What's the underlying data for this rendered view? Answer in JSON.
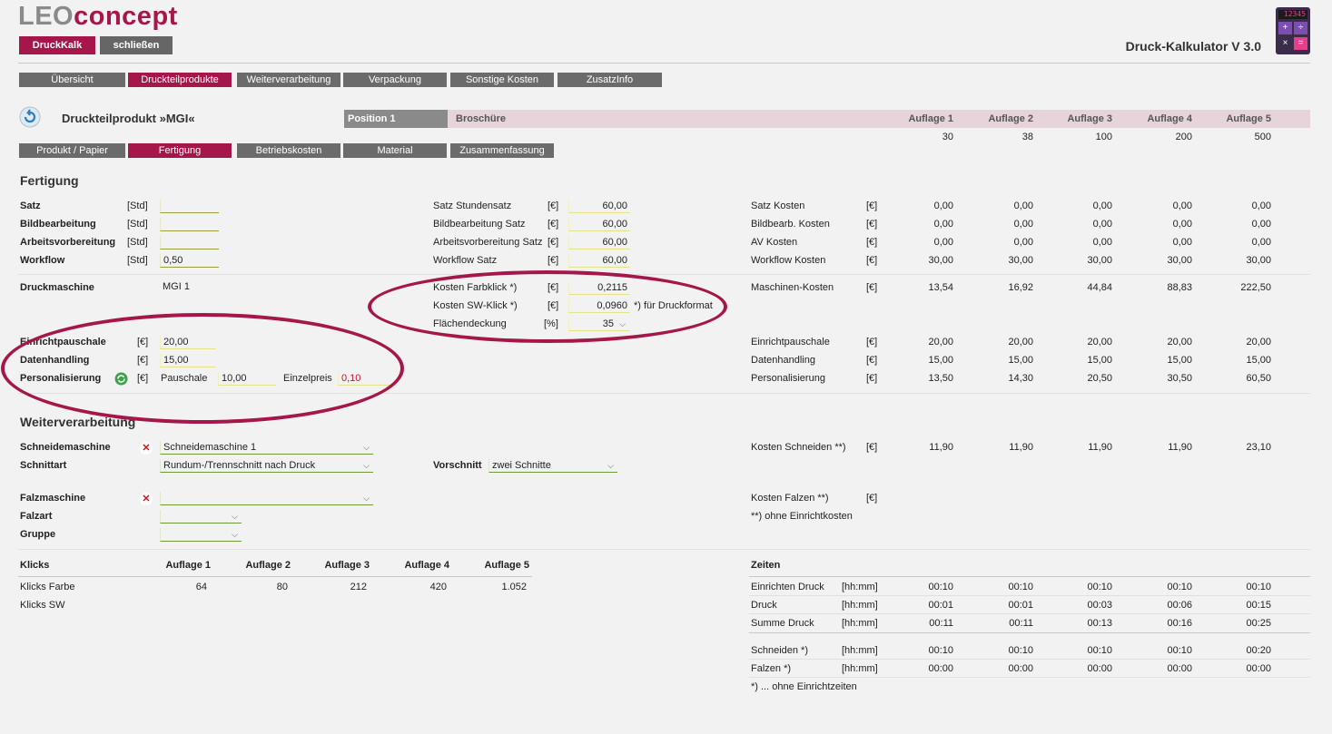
{
  "app": {
    "logo_leo": "LEO",
    "logo_concept": "concept",
    "btn_druckkalk": "DruckKalk",
    "btn_schliessen": "schließen",
    "title": "Druck-Kalkulator V 3.0",
    "calc_screen": "12345"
  },
  "main_tabs": [
    "Übersicht",
    "Druckteilprodukte",
    "Weiterverarbeitung",
    "Verpackung",
    "Sonstige Kosten",
    "ZusatzInfo"
  ],
  "product": {
    "title": "Druckteilprodukt »MGI«",
    "position": "Position 1",
    "product_type": "Broschüre",
    "auflage_headers": [
      "Auflage 1",
      "Auflage 2",
      "Auflage 3",
      "Auflage 4",
      "Auflage 5"
    ],
    "auflage_values": [
      "30",
      "38",
      "100",
      "200",
      "500"
    ]
  },
  "sub_tabs": [
    "Produkt / Papier",
    "Fertigung",
    "Betriebskosten",
    "Material",
    "Zusammenfassung"
  ],
  "fertigung": {
    "heading": "Fertigung",
    "left_rows": [
      {
        "label": "Satz",
        "unit": "[Std]",
        "value": ""
      },
      {
        "label": "Bildbearbeitung",
        "unit": "[Std]",
        "value": ""
      },
      {
        "label": "Arbeitsvorbereitung",
        "unit": "[Std]",
        "value": ""
      },
      {
        "label": "Workflow",
        "unit": "[Std]",
        "value": "0,50"
      }
    ],
    "mid_rows": [
      {
        "label": "Satz Stundensatz",
        "unit": "[€]",
        "value": "60,00"
      },
      {
        "label": "Bildbearbeitung Satz",
        "unit": "[€]",
        "value": "60,00"
      },
      {
        "label": "Arbeitsvorbereitung Satz",
        "unit": "[€]",
        "value": "60,00"
      },
      {
        "label": "Workflow Satz",
        "unit": "[€]",
        "value": "60,00"
      }
    ],
    "right_rows": [
      {
        "label": "Satz Kosten",
        "unit": "[€]",
        "values": [
          "0,00",
          "0,00",
          "0,00",
          "0,00",
          "0,00"
        ]
      },
      {
        "label": "Bildbearb. Kosten",
        "unit": "[€]",
        "values": [
          "0,00",
          "0,00",
          "0,00",
          "0,00",
          "0,00"
        ]
      },
      {
        "label": "AV Kosten",
        "unit": "[€]",
        "values": [
          "0,00",
          "0,00",
          "0,00",
          "0,00",
          "0,00"
        ]
      },
      {
        "label": "Workflow Kosten",
        "unit": "[€]",
        "values": [
          "30,00",
          "30,00",
          "30,00",
          "30,00",
          "30,00"
        ]
      }
    ],
    "druckmaschine_label": "Druckmaschine",
    "druckmaschine_value": "MGI 1",
    "farbklick_label": "Kosten Farbklick *)",
    "farbklick_unit": "[€]",
    "farbklick_value": "0,2115",
    "swklick_label": "Kosten SW-Klick *)",
    "swklick_unit": "[€]",
    "swklick_value": "0,0960",
    "druckformat_note": "*) für Druckformat",
    "flaechen_label": "Flächendeckung",
    "flaechen_unit": "[%]",
    "flaechen_value": "35",
    "maschinen_label": "Maschinen-Kosten",
    "maschinen_unit": "[€]",
    "maschinen_values": [
      "13,54",
      "16,92",
      "44,84",
      "88,83",
      "222,50"
    ],
    "einricht_label": "Einrichtpauschale",
    "einricht_unit": "[€]",
    "einricht_value": "20,00",
    "daten_label": "Datenhandling",
    "daten_unit": "[€]",
    "daten_value": "15,00",
    "perso_label": "Personalisierung",
    "perso_unit": "[€]",
    "pauschale_label": "Pauschale",
    "pauschale_value": "10,00",
    "einzelpreis_label": "Einzelpreis",
    "einzelpreis_value": "0,10",
    "right_rows2": [
      {
        "label": "Einrichtpauschale",
        "unit": "[€]",
        "values": [
          "20,00",
          "20,00",
          "20,00",
          "20,00",
          "20,00"
        ]
      },
      {
        "label": "Datenhandling",
        "unit": "[€]",
        "values": [
          "15,00",
          "15,00",
          "15,00",
          "15,00",
          "15,00"
        ]
      },
      {
        "label": "Personalisierung",
        "unit": "[€]",
        "values": [
          "13,50",
          "14,30",
          "20,50",
          "30,50",
          "60,50"
        ]
      }
    ]
  },
  "weiter": {
    "heading": "Weiterverarbeitung",
    "schneid_label": "Schneidemaschine",
    "schneid_value": "Schneidemaschine 1",
    "schnittart_label": "Schnittart",
    "schnittart_value": "Rundum-/Trennschnitt nach Druck",
    "vorschnitt_label": "Vorschnitt",
    "vorschnitt_value": "zwei Schnitte",
    "falz_label": "Falzmaschine",
    "falz_value": "",
    "falzart_label": "Falzart",
    "gruppe_label": "Gruppe",
    "kosten_schneiden_label": "Kosten Schneiden **)",
    "kosten_schneiden_unit": "[€]",
    "kosten_schneiden_values": [
      "11,90",
      "11,90",
      "11,90",
      "11,90",
      "23,10"
    ],
    "kosten_falzen_label": "Kosten Falzen **)",
    "kosten_falzen_unit": "[€]",
    "note_einricht": "**) ohne Einrichtkosten"
  },
  "klicks": {
    "label": "Klicks",
    "headers": [
      "Auflage 1",
      "Auflage 2",
      "Auflage 3",
      "Auflage 4",
      "Auflage 5"
    ],
    "farbe_label": "Klicks Farbe",
    "farbe_values": [
      "64",
      "80",
      "212",
      "420",
      "1.052"
    ],
    "sw_label": "Klicks SW"
  },
  "zeiten": {
    "label": "Zeiten",
    "rows": [
      {
        "label": "Einrichten Druck",
        "unit": "[hh:mm]",
        "values": [
          "00:10",
          "00:10",
          "00:10",
          "00:10",
          "00:10"
        ]
      },
      {
        "label": "Druck",
        "unit": "[hh:mm]",
        "values": [
          "00:01",
          "00:01",
          "00:03",
          "00:06",
          "00:15"
        ]
      },
      {
        "label": "Summe Druck",
        "unit": "[hh:mm]",
        "values": [
          "00:11",
          "00:11",
          "00:13",
          "00:16",
          "00:25"
        ]
      },
      {
        "label": "Schneiden *)",
        "unit": "[hh:mm]",
        "values": [
          "00:10",
          "00:10",
          "00:10",
          "00:10",
          "00:20"
        ]
      },
      {
        "label": "Falzen *)",
        "unit": "[hh:mm]",
        "values": [
          "00:00",
          "00:00",
          "00:00",
          "00:00",
          "00:00"
        ]
      }
    ],
    "note": "*) ... ohne Einrichtzeiten"
  },
  "colors": {
    "accent": "#a5164a",
    "tab_grey": "#6b6b6b"
  }
}
